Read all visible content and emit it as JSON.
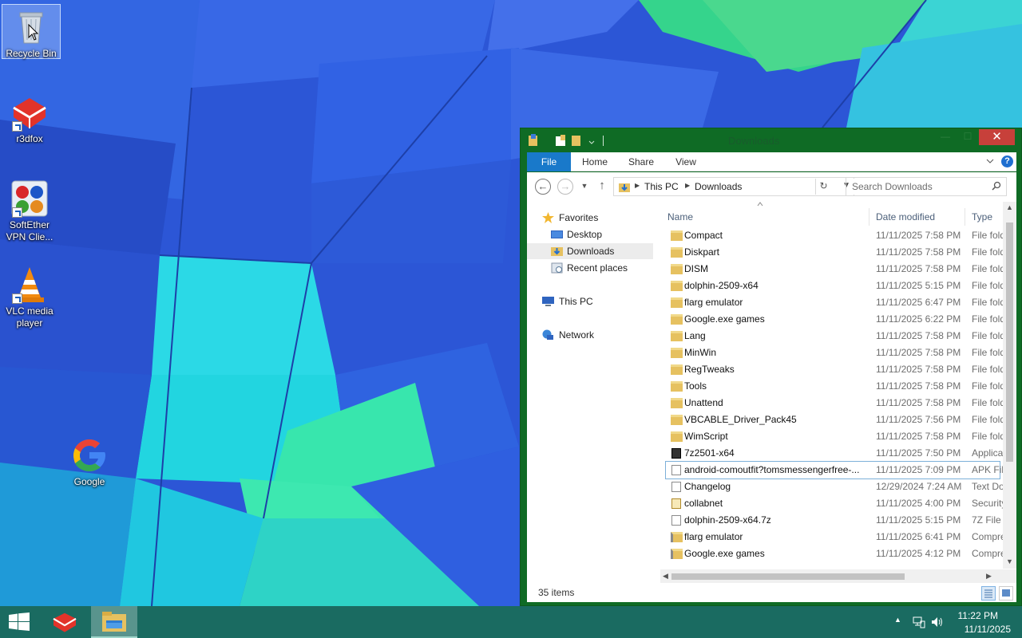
{
  "desktop": {
    "icons": [
      {
        "label": "Recycle Bin",
        "icon": "recycle-bin-icon"
      },
      {
        "label": "r3dfox",
        "icon": "r3dfox-icon"
      },
      {
        "label": "SoftEther VPN Clie...",
        "icon": "softether-vpn-icon"
      },
      {
        "label": "VLC media player",
        "icon": "vlc-icon"
      },
      {
        "label": "Google",
        "icon": "google-icon"
      }
    ]
  },
  "explorer": {
    "title": "Downloads",
    "close_glyph": "✕",
    "min_glyph": "—",
    "max_glyph": "☐",
    "ribbon_tabs": [
      "File",
      "Home",
      "Share",
      "View"
    ],
    "help_glyph": "?",
    "breadcrumb": [
      "This PC",
      "Downloads"
    ],
    "search_placeholder": "Search Downloads",
    "nav_pane": {
      "favorites": "Favorites",
      "favorites_items": [
        "Desktop",
        "Downloads",
        "Recent places"
      ],
      "this_pc": "This PC",
      "network": "Network"
    },
    "columns": {
      "name": "Name",
      "date": "Date modified",
      "type": "Type"
    },
    "files": [
      {
        "name": "Compact",
        "date": "11/11/2025 7:58 PM",
        "type": "File folder",
        "kind": "folder"
      },
      {
        "name": "Diskpart",
        "date": "11/11/2025 7:58 PM",
        "type": "File folder",
        "kind": "folder"
      },
      {
        "name": "DISM",
        "date": "11/11/2025 7:58 PM",
        "type": "File folder",
        "kind": "folder"
      },
      {
        "name": "dolphin-2509-x64",
        "date": "11/11/2025 5:15 PM",
        "type": "File folder",
        "kind": "folder"
      },
      {
        "name": "flarg emulator",
        "date": "11/11/2025 6:47 PM",
        "type": "File folder",
        "kind": "folder"
      },
      {
        "name": "Google.exe games",
        "date": "11/11/2025 6:22 PM",
        "type": "File folder",
        "kind": "folder"
      },
      {
        "name": "Lang",
        "date": "11/11/2025 7:58 PM",
        "type": "File folder",
        "kind": "folder"
      },
      {
        "name": "MinWin",
        "date": "11/11/2025 7:58 PM",
        "type": "File folder",
        "kind": "folder"
      },
      {
        "name": "RegTweaks",
        "date": "11/11/2025 7:58 PM",
        "type": "File folder",
        "kind": "folder"
      },
      {
        "name": "Tools",
        "date": "11/11/2025 7:58 PM",
        "type": "File folder",
        "kind": "folder"
      },
      {
        "name": "Unattend",
        "date": "11/11/2025 7:58 PM",
        "type": "File folder",
        "kind": "folder"
      },
      {
        "name": "VBCABLE_Driver_Pack45",
        "date": "11/11/2025 7:56 PM",
        "type": "File folder",
        "kind": "folder"
      },
      {
        "name": "WimScript",
        "date": "11/11/2025 7:58 PM",
        "type": "File folder",
        "kind": "folder"
      },
      {
        "name": "7z2501-x64",
        "date": "11/11/2025 7:50 PM",
        "type": "Application",
        "kind": "app"
      },
      {
        "name": "android-comoutfit?tomsmessengerfree-...",
        "date": "11/11/2025 7:09 PM",
        "type": "APK File",
        "kind": "file"
      },
      {
        "name": "Changelog",
        "date": "12/29/2024 7:24 AM",
        "type": "Text Document",
        "kind": "text"
      },
      {
        "name": "collabnet",
        "date": "11/11/2025 4:00 PM",
        "type": "Security Certificate",
        "kind": "cert"
      },
      {
        "name": "dolphin-2509-x64.7z",
        "date": "11/11/2025 5:15 PM",
        "type": "7Z File",
        "kind": "file"
      },
      {
        "name": "flarg emulator",
        "date": "11/11/2025 6:41 PM",
        "type": "Compressed",
        "kind": "zip"
      },
      {
        "name": "Google.exe games",
        "date": "11/11/2025 4:12 PM",
        "type": "Compressed",
        "kind": "zip"
      }
    ],
    "status": "35 items"
  },
  "taskbar": {
    "clock_time": "11:22 PM",
    "clock_date": "11/11/2025"
  },
  "colors": {
    "window_frame": "#0f6b25",
    "taskbar": "#1a6b61",
    "file_tab": "#1979ca",
    "close_button": "#c7403a"
  }
}
